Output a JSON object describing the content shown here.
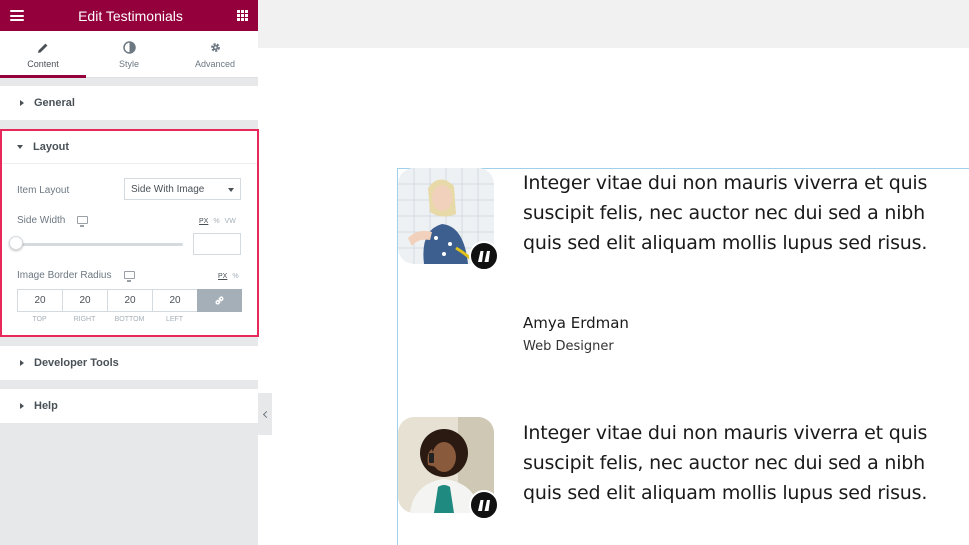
{
  "panel": {
    "title": "Edit Testimonials",
    "tabs": [
      {
        "label": "Content",
        "icon": "pencil-icon",
        "active": true
      },
      {
        "label": "Style",
        "icon": "half-circle-icon",
        "active": false
      },
      {
        "label": "Advanced",
        "icon": "gear-icon",
        "active": false
      }
    ],
    "sections": {
      "general": "General",
      "layout": "Layout",
      "developer_tools": "Developer Tools",
      "help": "Help"
    },
    "layout": {
      "item_layout_label": "Item Layout",
      "item_layout_value": "Side With Image",
      "side_width_label": "Side Width",
      "side_width_units": [
        "PX",
        "%",
        "VW"
      ],
      "side_width_value": "",
      "border_radius_label": "Image Border Radius",
      "border_radius_units": [
        "PX",
        "%"
      ],
      "border_radius_values": [
        "20",
        "20",
        "20",
        "20"
      ],
      "border_radius_sides": [
        "TOP",
        "RIGHT",
        "BOTTOM",
        "LEFT"
      ]
    },
    "accent_color": "#93003c",
    "highlight_color": "#e8285a"
  },
  "preview": {
    "testimonials": [
      {
        "text": "Integer vitae dui non mauris viverra et quis suscipit felis, nec auctor nec dui sed a nibh quis sed elit aliquam mollis lupus sed risus.",
        "name": "Amya Erdman",
        "role": "Web Designer"
      },
      {
        "text": "Integer vitae dui non mauris viverra et quis suscipit felis, nec auctor nec dui sed a nibh quis sed elit aliquam mollis lupus sed risus."
      }
    ]
  }
}
